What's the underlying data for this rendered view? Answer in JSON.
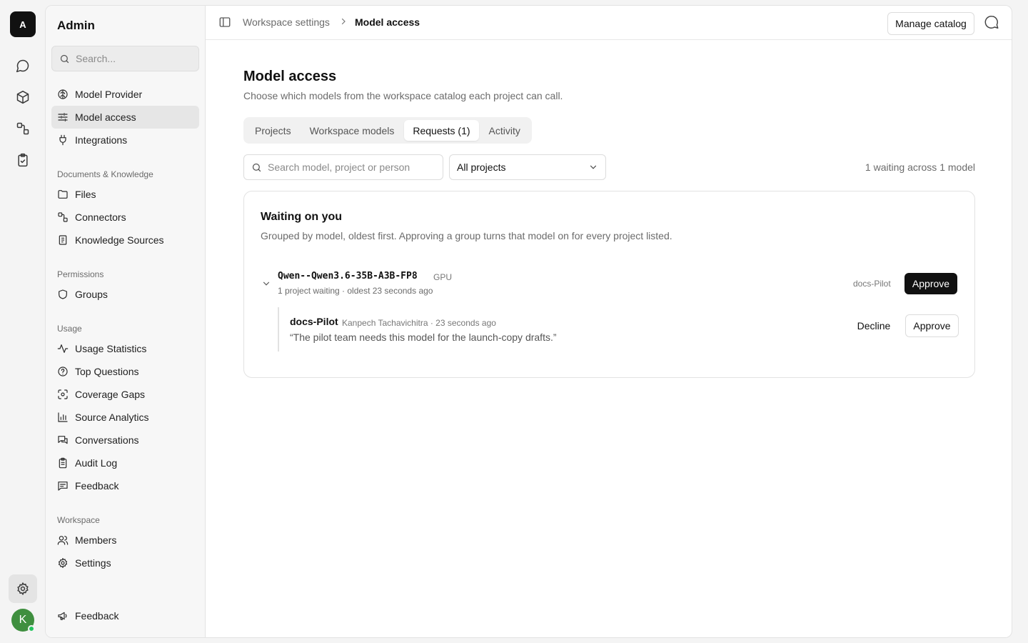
{
  "rail": {
    "logo_letter": "A",
    "avatar_letter": "K",
    "icons": [
      "chat-icon",
      "cube-icon",
      "connectors-icon",
      "clipboard-check-icon",
      "gear-icon"
    ]
  },
  "sidebar": {
    "title": "Admin",
    "search_placeholder": "Search...",
    "top_items": [
      {
        "label": "Model Provider",
        "icon": "brain-icon"
      },
      {
        "label": "Model access",
        "icon": "sliders-icon",
        "active": true
      },
      {
        "label": "Integrations",
        "icon": "plug-icon"
      }
    ],
    "sections": [
      {
        "title": "Documents & Knowledge",
        "items": [
          {
            "label": "Files",
            "icon": "folder-icon"
          },
          {
            "label": "Connectors",
            "icon": "connectors-icon"
          },
          {
            "label": "Knowledge Sources",
            "icon": "book-icon"
          }
        ]
      },
      {
        "title": "Permissions",
        "items": [
          {
            "label": "Groups",
            "icon": "shield-icon"
          }
        ]
      },
      {
        "title": "Usage",
        "items": [
          {
            "label": "Usage Statistics",
            "icon": "activity-icon"
          },
          {
            "label": "Top Questions",
            "icon": "question-icon"
          },
          {
            "label": "Coverage Gaps",
            "icon": "scan-icon"
          },
          {
            "label": "Source Analytics",
            "icon": "bar-chart-icon"
          },
          {
            "label": "Conversations",
            "icon": "messages-icon"
          },
          {
            "label": "Audit Log",
            "icon": "clipboard-list-icon"
          },
          {
            "label": "Feedback",
            "icon": "message-square-icon"
          }
        ]
      },
      {
        "title": "Workspace",
        "items": [
          {
            "label": "Members",
            "icon": "users-icon"
          },
          {
            "label": "Settings",
            "icon": "gear-icon"
          }
        ]
      }
    ],
    "footer_item": {
      "label": "Feedback",
      "icon": "megaphone-icon"
    }
  },
  "topbar": {
    "breadcrumb_parent": "Workspace settings",
    "breadcrumb_current": "Model access",
    "manage_button": "Manage catalog"
  },
  "page": {
    "title": "Model access",
    "subtitle": "Choose which models from the workspace catalog each project can call.",
    "tabs": [
      {
        "label": "Projects"
      },
      {
        "label": "Workspace models"
      },
      {
        "label": "Requests (1)",
        "active": true
      },
      {
        "label": "Activity"
      }
    ],
    "search_placeholder": "Search model, project or person",
    "project_filter": "All projects",
    "waiting_summary": "1 waiting across 1 model"
  },
  "card": {
    "title": "Waiting on you",
    "subtitle": "Grouped by model, oldest first. Approving a group turns that model on for every project listed.",
    "group": {
      "model": "Qwen--Qwen3.6-35B-A3B-FP8",
      "tag": "GPU",
      "meta": "1 project waiting · oldest 23 seconds ago",
      "projects": "docs-Pilot",
      "approve_label": "Approve",
      "request": {
        "project": "docs-Pilot",
        "person_time": "Kanpech Tachavichitra · 23 seconds ago",
        "quote": "“The pilot team needs this model for the launch-copy drafts.”",
        "decline_label": "Decline",
        "approve_label": "Approve"
      }
    }
  }
}
